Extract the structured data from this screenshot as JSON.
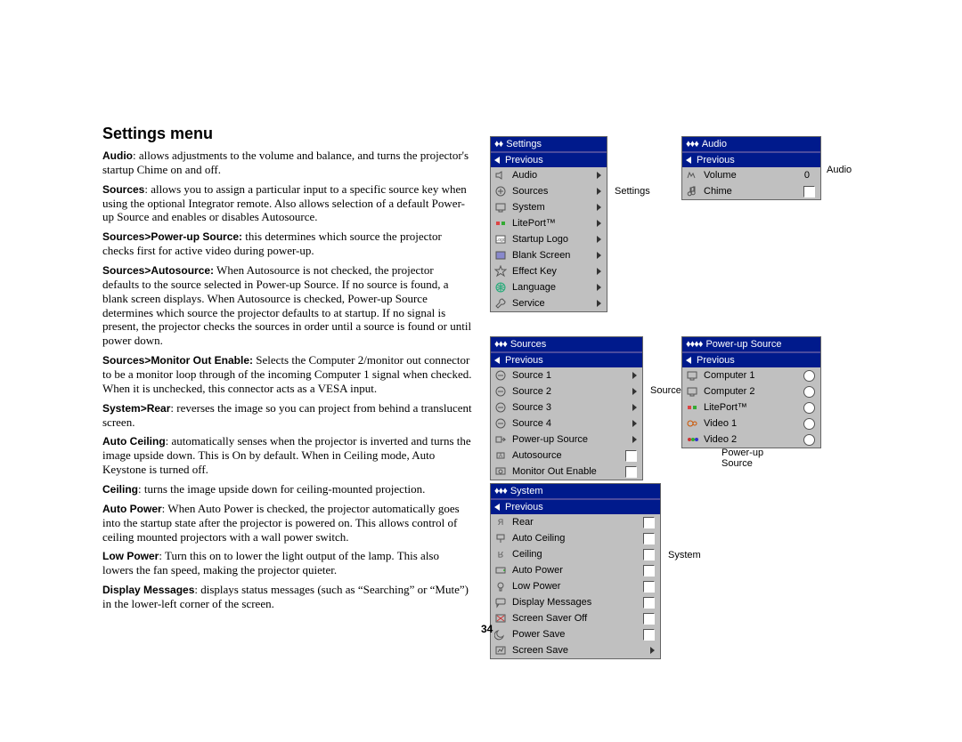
{
  "page_number": "34",
  "heading": "Settings menu",
  "paragraphs": {
    "audio_label": "Audio",
    "audio": ": allows adjustments to the volume and balance, and turns the projector's startup Chime on and off.",
    "sources_label": "Sources",
    "sources": ": allows you to assign a particular input to a specific source key when using the optional Integrator remote. Also allows selection of a default Power-up Source and enables or disables Autosource.",
    "pus_label": "Sources>Power-up Source:",
    "pus": " this determines which source the projector checks first for active video during power-up.",
    "auto_label": "Sources>Autosource:",
    "auto": " When Autosource is not checked, the projector defaults to the source selected in Power-up Source. If no source is found, a blank screen displays. When Autosource is checked, Power-up Source determines which source the projector defaults to at startup. If no signal is present, the projector checks the sources in order until a source is found or until power down.",
    "mon_label": "Sources>Monitor Out Enable:",
    "mon": " Selects the Computer 2/monitor out connector to be a monitor loop through of the incoming Computer 1 signal when checked. When it is unchecked, this connector acts as a VESA input.",
    "rear_label": "System>Rear",
    "rear": ": reverses the image so you can project from behind a translucent screen.",
    "ac_label": "Auto Ceiling",
    "ac": ": automatically senses when the projector is inverted and turns the image upside down. This is On by default. When in Ceiling mode, Auto Keystone is turned off.",
    "ceil_label": "Ceiling",
    "ceil": ": turns the image upside down for ceiling-mounted projection.",
    "ap_label": "Auto Power",
    "ap": ": When Auto Power is checked, the projector automatically goes into the startup state after the projector is powered on. This allows control of ceiling mounted projectors with a wall power switch.",
    "lp_label": "Low Power",
    "lp": ": Turn this on to lower the light output of the lamp. This also lowers the fan speed, making the projector quieter.",
    "dm_label": "Display Messages",
    "dm": ": displays status messages (such as “Searching” or “Mute”) in the lower-left corner of the screen."
  },
  "side_labels": {
    "settings": "Settings",
    "audio": "Audio",
    "sources": "Sources",
    "system": "System",
    "powerup": "Power-up Source"
  },
  "panels": {
    "settings": {
      "title": "Settings",
      "diamonds": "♦♦",
      "previous": "Previous",
      "rows": [
        {
          "icon": "audio",
          "label": "Audio",
          "kind": "arw"
        },
        {
          "icon": "src",
          "label": "Sources",
          "kind": "arw"
        },
        {
          "icon": "sys",
          "label": "System",
          "kind": "arw"
        },
        {
          "icon": "lp",
          "label": "LitePort™",
          "kind": "arw"
        },
        {
          "icon": "logo",
          "label": "Startup Logo",
          "kind": "arw"
        },
        {
          "icon": "blank",
          "label": "Blank Screen",
          "kind": "arw"
        },
        {
          "icon": "star",
          "label": "Effect Key",
          "kind": "arw"
        },
        {
          "icon": "globe",
          "label": "Language",
          "kind": "arw"
        },
        {
          "icon": "wrench",
          "label": "Service",
          "kind": "arw"
        }
      ]
    },
    "audio": {
      "title": "Audio",
      "diamonds": "♦♦♦",
      "previous": "Previous",
      "rows": [
        {
          "icon": "vol",
          "label": "Volume",
          "kind": "val",
          "val": "0"
        },
        {
          "icon": "note",
          "label": "Chime",
          "kind": "chk"
        }
      ]
    },
    "sources": {
      "title": "Sources",
      "diamonds": "♦♦♦",
      "previous": "Previous",
      "rows": [
        {
          "icon": "sn",
          "label": "Source 1",
          "kind": "arw"
        },
        {
          "icon": "sn",
          "label": "Source 2",
          "kind": "arw"
        },
        {
          "icon": "sn",
          "label": "Source 3",
          "kind": "arw"
        },
        {
          "icon": "sn",
          "label": "Source 4",
          "kind": "arw"
        },
        {
          "icon": "pus",
          "label": "Power-up Source",
          "kind": "arw"
        },
        {
          "icon": "as",
          "label": "Autosource",
          "kind": "chk"
        },
        {
          "icon": "mo",
          "label": "Monitor Out Enable",
          "kind": "chk"
        }
      ]
    },
    "powerup": {
      "title": "Power-up Source",
      "diamonds": "♦♦♦♦",
      "previous": "Previous",
      "rows": [
        {
          "icon": "comp",
          "label": "Computer 1",
          "kind": "radio"
        },
        {
          "icon": "comp",
          "label": "Computer 2",
          "kind": "radio"
        },
        {
          "icon": "lp",
          "label": "LitePort™",
          "kind": "radio"
        },
        {
          "icon": "vid",
          "label": "Video 1",
          "kind": "radio"
        },
        {
          "icon": "vid2",
          "label": "Video 2",
          "kind": "radio"
        }
      ]
    },
    "system": {
      "title": "System",
      "diamonds": "♦♦♦",
      "previous": "Previous",
      "rows": [
        {
          "icon": "rear",
          "label": "Rear",
          "kind": "chk"
        },
        {
          "icon": "aceil",
          "label": "Auto Ceiling",
          "kind": "chk"
        },
        {
          "icon": "ceil",
          "label": "Ceiling",
          "kind": "chk"
        },
        {
          "icon": "apow",
          "label": "Auto Power",
          "kind": "chk"
        },
        {
          "icon": "lpow",
          "label": "Low Power",
          "kind": "chk"
        },
        {
          "icon": "msg",
          "label": "Display Messages",
          "kind": "chk"
        },
        {
          "icon": "ss",
          "label": "Screen Saver Off",
          "kind": "chk"
        },
        {
          "icon": "ps",
          "label": "Power Save",
          "kind": "chk"
        },
        {
          "icon": "ssave",
          "label": "Screen Save",
          "kind": "arw"
        }
      ]
    }
  }
}
